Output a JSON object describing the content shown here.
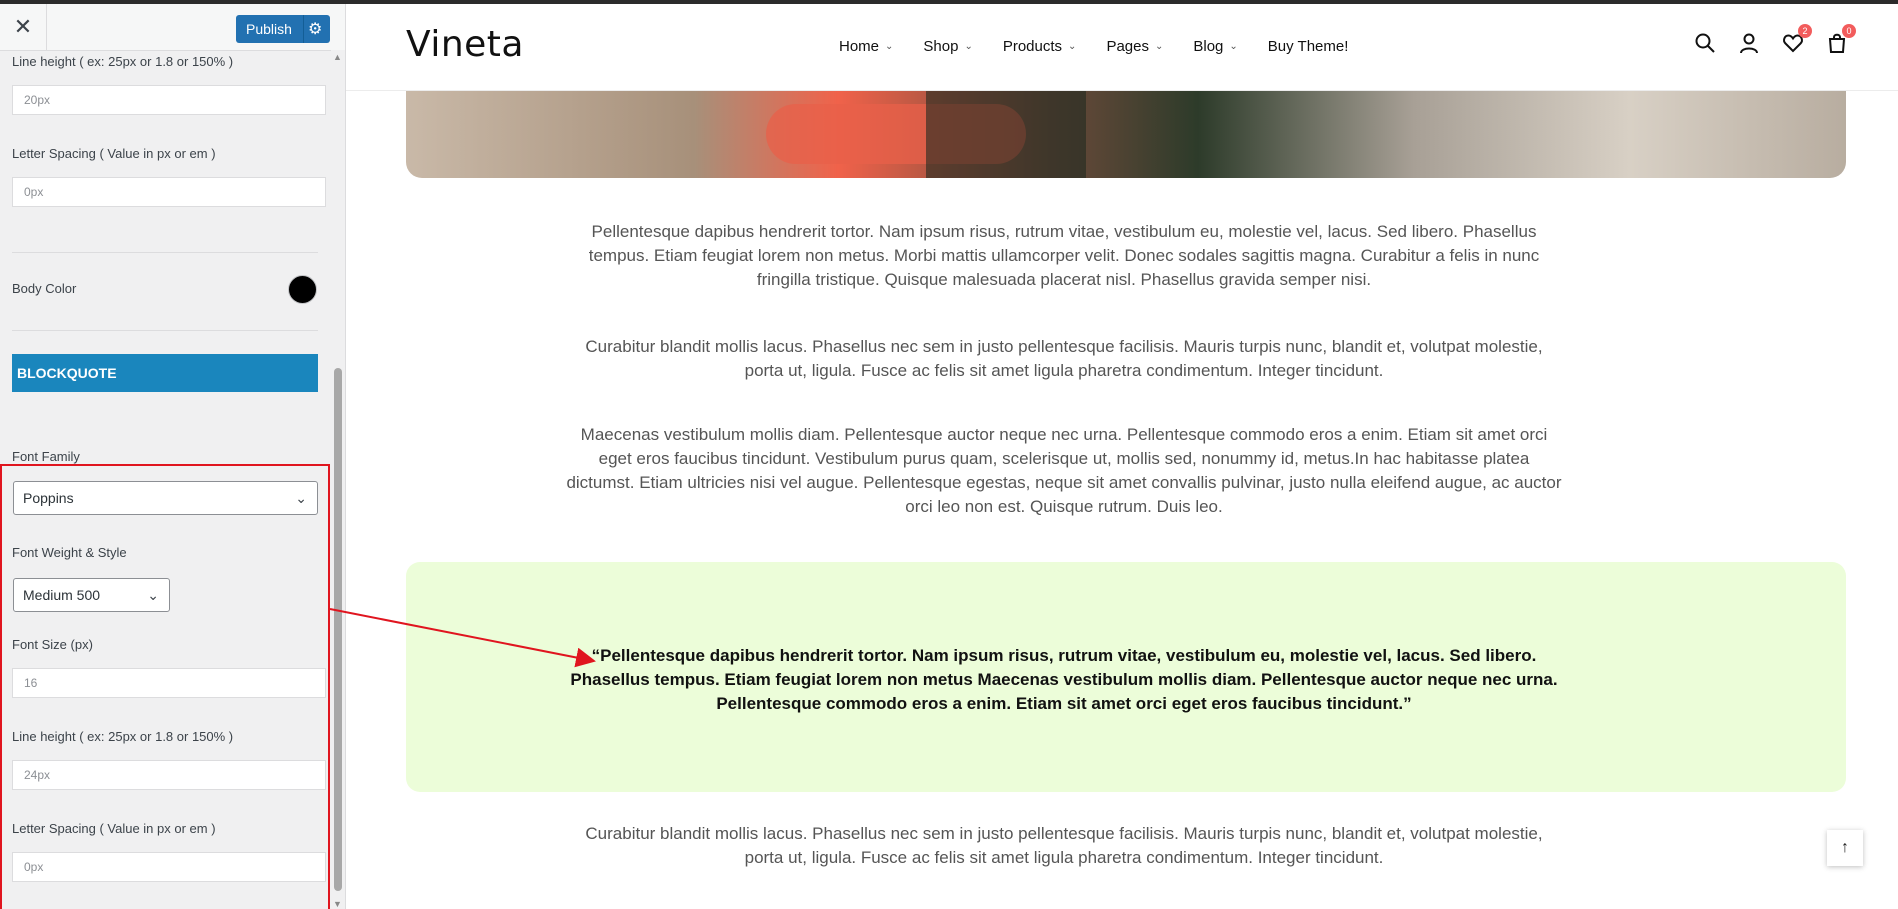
{
  "customizer": {
    "close_icon": "close-icon",
    "publish_label": "Publish",
    "gear_icon": "gear-icon",
    "fields": {
      "line_height_1_label": "Line height ( ex: 25px or 1.8 or 150% )",
      "line_height_1_placeholder": "20px",
      "letter_spacing_1_label": "Letter Spacing ( Value in px or em )",
      "letter_spacing_1_placeholder": "0px",
      "body_color_label": "Body Color",
      "body_color_value": "#000000",
      "section_title": "BLOCKQUOTE",
      "font_family_label": "Font Family",
      "font_family_value": "Poppins",
      "font_weight_label": "Font Weight & Style",
      "font_weight_value": "Medium 500",
      "font_size_label": "Font Size (px)",
      "font_size_placeholder": "16",
      "line_height_2_label": "Line height ( ex: 25px or 1.8 or 150% )",
      "line_height_2_placeholder": "24px",
      "letter_spacing_2_label": "Letter Spacing ( Value in px or em )",
      "letter_spacing_2_placeholder": "0px"
    },
    "accent_color": "#2271b1",
    "section_color": "#1a86bd",
    "highlight_color": "#e0151f"
  },
  "site": {
    "logo": "Vineta",
    "nav": [
      "Home",
      "Shop",
      "Products",
      "Pages",
      "Blog",
      "Buy Theme!"
    ],
    "wishlist_count": "2",
    "cart_count": "0",
    "paragraphs": [
      "Pellentesque dapibus hendrerit tortor. Nam ipsum risus, rutrum vitae, vestibulum eu, molestie vel, lacus. Sed libero. Phasellus tempus. Etiam feugiat lorem non metus. Morbi mattis ullamcorper velit. Donec sodales sagittis magna. Curabitur a felis in nunc fringilla tristique. Quisque malesuada placerat nisl. Phasellus gravida semper nisi.",
      "Curabitur blandit mollis lacus. Phasellus nec sem in justo pellentesque facilisis. Mauris turpis nunc, blandit et, volutpat molestie, porta ut, ligula. Fusce ac felis sit amet ligula pharetra condimentum. Integer tincidunt.",
      "Maecenas vestibulum mollis diam. Pellentesque auctor neque nec urna. Pellentesque commodo eros a enim. Etiam sit amet orci eget eros faucibus tincidunt. Vestibulum purus quam, scelerisque ut, mollis sed, nonummy id, metus.In hac habitasse platea dictumst. Etiam ultricies nisi vel augue. Pellentesque egestas, neque sit amet convallis pulvinar, justo nulla eleifend augue, ac auctor orci leo non est. Quisque rutrum. Duis leo.",
      "Curabitur blandit mollis lacus. Phasellus nec sem in justo pellentesque facilisis. Mauris turpis nunc, blandit et, volutpat molestie, porta ut, ligula. Fusce ac felis sit amet ligula pharetra condimentum. Integer tincidunt."
    ],
    "blockquote": "“Pellentesque dapibus hendrerit tortor. Nam ipsum risus, rutrum vitae, vestibulum eu, molestie vel, lacus. Sed libero. Phasellus tempus. Etiam feugiat lorem non metus Maecenas vestibulum mollis diam. Pellentesque auctor neque nec urna. Pellentesque commodo eros a enim. Etiam sit amet orci eget eros faucibus tincidunt.”",
    "blockquote_bg": "#ecfdd9",
    "badge_color": "#f25c5c",
    "icons": [
      "search-icon",
      "user-icon",
      "heart-icon",
      "bag-icon",
      "arrow-up-icon"
    ]
  }
}
